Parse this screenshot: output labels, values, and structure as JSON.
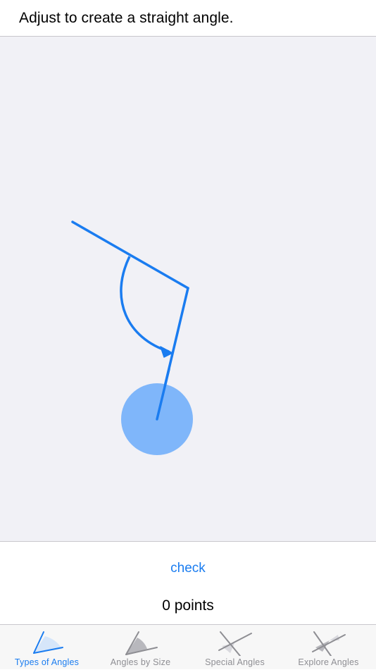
{
  "header": {
    "title": "Adjust to create a straight angle."
  },
  "actions": {
    "check_label": "check"
  },
  "score": {
    "points_label": "0 points"
  },
  "tabs": [
    {
      "label": "Types of Angles",
      "icon": "acute-angle-icon",
      "active": true
    },
    {
      "label": "Angles by Size",
      "icon": "angle-size-icon",
      "active": false
    },
    {
      "label": "Special Angles",
      "icon": "crossed-lines-icon",
      "active": false
    },
    {
      "label": "Explore Angles",
      "icon": "explore-angle-icon",
      "active": false
    }
  ],
  "colors": {
    "accent": "#1a7cf0",
    "handle": "#7fb6fa",
    "canvas_bg": "#f1f1f6",
    "tab_inactive": "#8e8e93"
  }
}
